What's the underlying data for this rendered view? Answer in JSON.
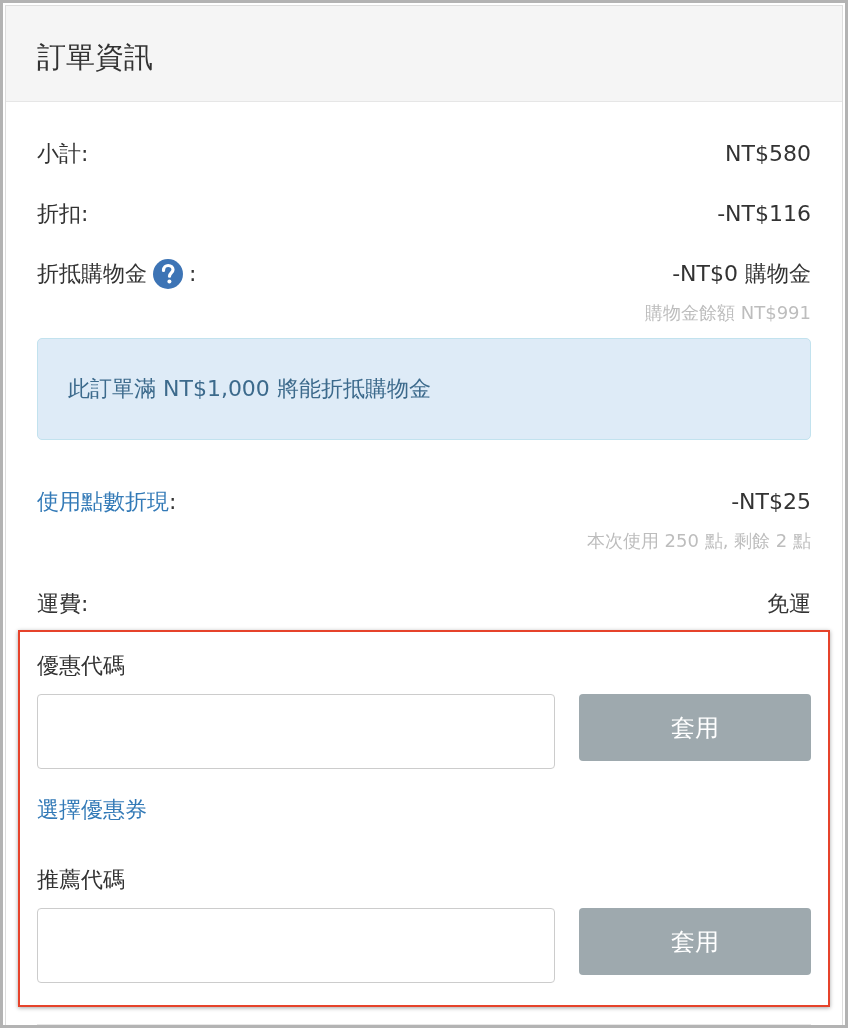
{
  "panel": {
    "title": "訂單資訊"
  },
  "items": [
    {
      "kind": "plain",
      "label": "小計:",
      "value": "NT$580"
    },
    {
      "kind": "plain",
      "label": "折扣:",
      "value": "-NT$116"
    },
    {
      "kind": "help",
      "label": "折抵購物金",
      "suffix": ":",
      "value": "-NT$0 購物金",
      "note": "購物金餘額 NT$991"
    },
    {
      "kind": "notice",
      "text": "此訂單滿 NT$1,000 將能折抵購物金"
    },
    {
      "kind": "link",
      "label": "使用點數折現",
      "suffix": ":",
      "value": "-NT$25",
      "note": "本次使用 250 點, 剩餘 2 點"
    },
    {
      "kind": "plain",
      "label": "運費:",
      "value": "免運"
    }
  ],
  "code_section": {
    "entries": [
      {
        "kind": "code",
        "label": "優惠代碼",
        "button": "套用"
      },
      {
        "kind": "link",
        "text": "選擇優惠券"
      },
      {
        "kind": "code",
        "label": "推薦代碼",
        "button": "套用"
      }
    ]
  }
}
